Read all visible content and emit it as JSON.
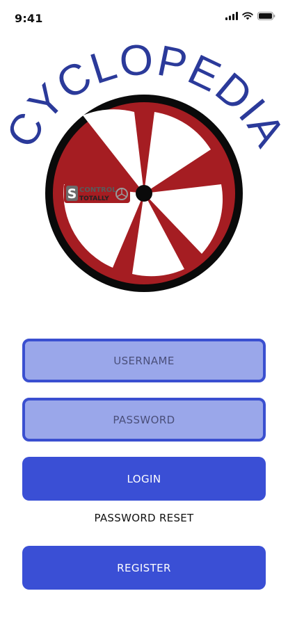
{
  "status_bar": {
    "time": "9:41",
    "icons": [
      "cellular-signal-icon",
      "wifi-icon",
      "battery-icon"
    ]
  },
  "logo": {
    "title": "CYCLOPEDIA",
    "badge_line1": "CONTROL",
    "badge_line2": "TOTALLY",
    "badge_letter": "S",
    "colors": {
      "title": "#2b3a9a",
      "wheel_rim": "#0a0a0a",
      "wheel_red": "#a51d22",
      "hub": "#0a0a0a"
    }
  },
  "form": {
    "username_placeholder": "USERNAME",
    "password_placeholder": "PASSWORD",
    "login_label": "LOGIN",
    "password_reset_label": "PASSWORD RESET",
    "register_label": "REGISTER"
  },
  "colors": {
    "accent": "#3a4fd5",
    "field_fill": "#9aa7ea",
    "field_border": "#3a4fd0"
  }
}
